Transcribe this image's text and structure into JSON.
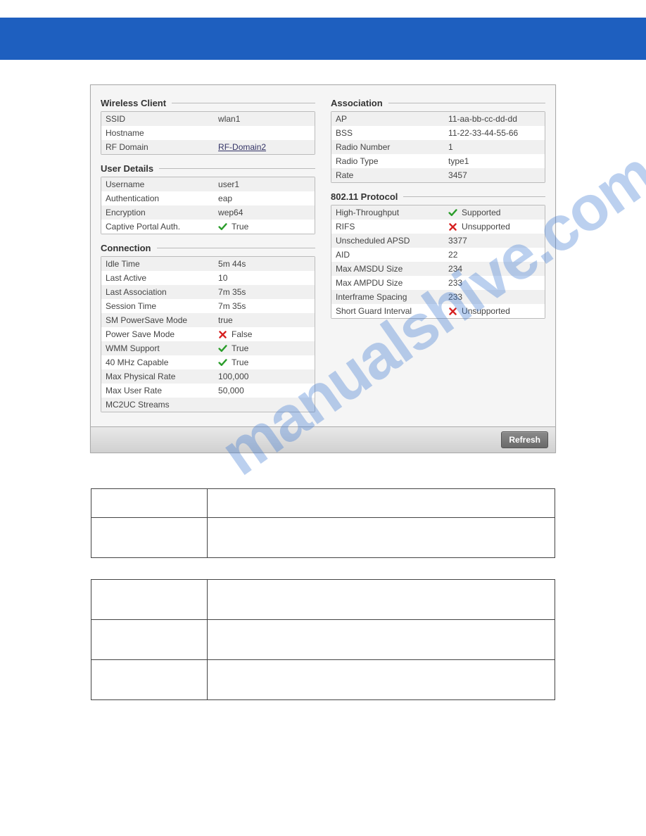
{
  "watermark": "manualshive.com",
  "refresh_label": "Refresh",
  "left_col": {
    "wireless_client": {
      "title": "Wireless Client",
      "rows": [
        {
          "label": "SSID",
          "value": "wlan1"
        },
        {
          "label": "Hostname",
          "value": ""
        },
        {
          "label": "RF Domain",
          "value": "RF-Domain2",
          "link": true
        }
      ]
    },
    "user_details": {
      "title": "User Details",
      "rows": [
        {
          "label": "Username",
          "value": "user1"
        },
        {
          "label": "Authentication",
          "value": "eap"
        },
        {
          "label": "Encryption",
          "value": "wep64"
        },
        {
          "label": "Captive Portal Auth.",
          "value": "True",
          "icon": "check"
        }
      ]
    },
    "connection": {
      "title": "Connection",
      "rows": [
        {
          "label": "Idle Time",
          "value": "5m 44s"
        },
        {
          "label": "Last Active",
          "value": "10"
        },
        {
          "label": "Last Association",
          "value": "7m 35s"
        },
        {
          "label": "Session Time",
          "value": "7m 35s"
        },
        {
          "label": "SM PowerSave Mode",
          "value": "true"
        },
        {
          "label": "Power Save Mode",
          "value": "False",
          "icon": "cross"
        },
        {
          "label": "WMM Support",
          "value": "True",
          "icon": "check"
        },
        {
          "label": "40 MHz Capable",
          "value": "True",
          "icon": "check"
        },
        {
          "label": "Max Physical Rate",
          "value": "100,000"
        },
        {
          "label": "Max User Rate",
          "value": "50,000"
        },
        {
          "label": "MC2UC Streams",
          "value": ""
        }
      ]
    }
  },
  "right_col": {
    "association": {
      "title": "Association",
      "rows": [
        {
          "label": "AP",
          "value": "11-aa-bb-cc-dd-dd"
        },
        {
          "label": "BSS",
          "value": "11-22-33-44-55-66"
        },
        {
          "label": "Radio Number",
          "value": "1"
        },
        {
          "label": "Radio Type",
          "value": "type1"
        },
        {
          "label": "Rate",
          "value": "3457"
        }
      ]
    },
    "protocol": {
      "title": "802.11 Protocol",
      "rows": [
        {
          "label": "High-Throughput",
          "value": "Supported",
          "icon": "check"
        },
        {
          "label": "RIFS",
          "value": "Unsupported",
          "icon": "cross"
        },
        {
          "label": "Unscheduled APSD",
          "value": "3377"
        },
        {
          "label": "AID",
          "value": "22"
        },
        {
          "label": "Max AMSDU Size",
          "value": "234"
        },
        {
          "label": "Max AMPDU Size",
          "value": "233"
        },
        {
          "label": "Interframe Spacing",
          "value": "233"
        },
        {
          "label": "Short Guard Interval",
          "value": "Unsupported",
          "icon": "cross"
        }
      ]
    }
  }
}
